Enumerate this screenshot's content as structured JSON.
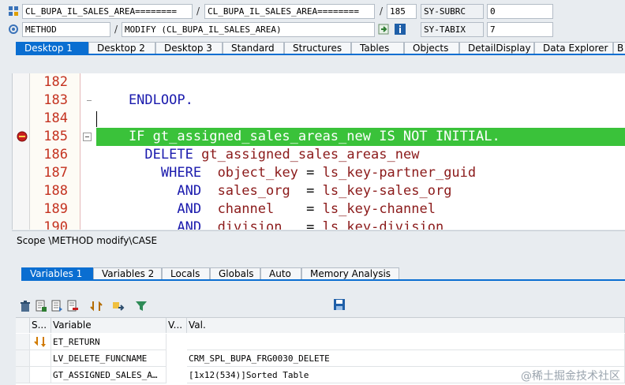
{
  "header": {
    "row1": {
      "class_field": "CL_BUPA_IL_SALES_AREA========",
      "slash1": "/",
      "include_field": "CL_BUPA_IL_SALES_AREA========",
      "slash2": "/",
      "line_field": "185",
      "sys_var_name": "SY-SUBRC",
      "sys_var_value": "0"
    },
    "row2": {
      "type_field": "METHOD",
      "slash": "/",
      "event_field": "MODIFY (CL_BUPA_IL_SALES_AREA)",
      "sys_var_name": "SY-TABIX",
      "sys_var_value": "7"
    }
  },
  "desktop_tabs": [
    "Desktop 1",
    "Desktop 2",
    "Desktop 3",
    "Standard",
    "Structures",
    "Tables",
    "Objects",
    "DetailDisplay",
    "Data Explorer",
    "B"
  ],
  "editor": {
    "lines": [
      {
        "num": "182",
        "code": ""
      },
      {
        "num": "183",
        "code": "    ENDLOOP."
      },
      {
        "num": "184",
        "code": ""
      },
      {
        "num": "185",
        "code": "    IF gt_assigned_sales_areas_new IS NOT INITIAL."
      },
      {
        "num": "186",
        "code": "      DELETE gt_assigned_sales_areas_new"
      },
      {
        "num": "187",
        "code": "        WHERE  object_key = ls_key-partner_guid"
      },
      {
        "num": "188",
        "code": "          AND  sales_org  = ls_key-sales_org"
      },
      {
        "num": "189",
        "code": "          AND  channel    = ls_key-channel"
      },
      {
        "num": "190",
        "code": "          AND  division   = ls_key-division"
      }
    ],
    "current_line": "185"
  },
  "scope_text": "Scope \\METHOD modify\\CASE",
  "variable_tabs": [
    "Variables 1",
    "Variables 2",
    "Locals",
    "Globals",
    "Auto",
    "Memory Analysis"
  ],
  "variables_table": {
    "headers": {
      "s": "S...",
      "variable": "Variable",
      "v": "V...",
      "val": "Val."
    },
    "rows": [
      {
        "variable": "ET_RETURN",
        "value": ""
      },
      {
        "variable": "LV_DELETE_FUNCNAME",
        "value": "CRM_SPL_BUPA_FRG0030_DELETE"
      },
      {
        "variable": "GT_ASSIGNED_SALES_A…",
        "value": "[1x12(534)]Sorted Table"
      }
    ]
  },
  "watermark": "@稀土掘金技术社区",
  "colors": {
    "accent": "#0a6ed1",
    "highlight": "#3ac23a",
    "keyword": "#1a1aad",
    "identifier": "#8b1a1a",
    "line_number": "#c4321f"
  }
}
